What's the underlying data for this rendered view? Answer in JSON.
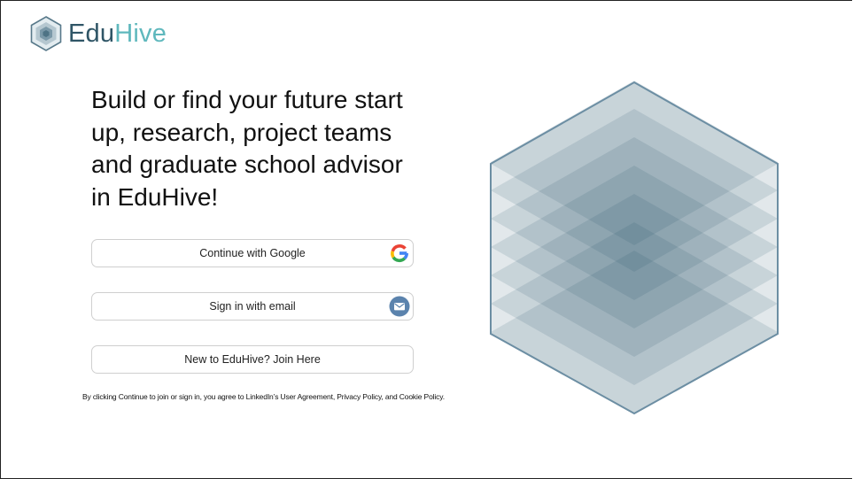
{
  "brand": {
    "name_part1": "Edu",
    "name_part2": "Hive",
    "colors": {
      "dark": "#2f5566",
      "light": "#5fb8bd"
    }
  },
  "hero": {
    "headline": "Build or find your future start up, research, project teams and graduate school advisor in EduHive!"
  },
  "auth": {
    "google_label": "Continue with Google",
    "google_icon": "google-icon",
    "email_label": "Sign in with email",
    "email_icon": "envelope-icon",
    "join_label": "New to EduHive? Join Here"
  },
  "legal": {
    "text": "By clicking Continue to join or sign in, you agree to LinkedIn’s User Agreement, Privacy Policy, and Cookie Policy."
  },
  "illustration": {
    "icon": "hexagon-layers-illustration",
    "colors": {
      "fill": "#1f4e63",
      "outline": "#6c8ea3"
    }
  }
}
